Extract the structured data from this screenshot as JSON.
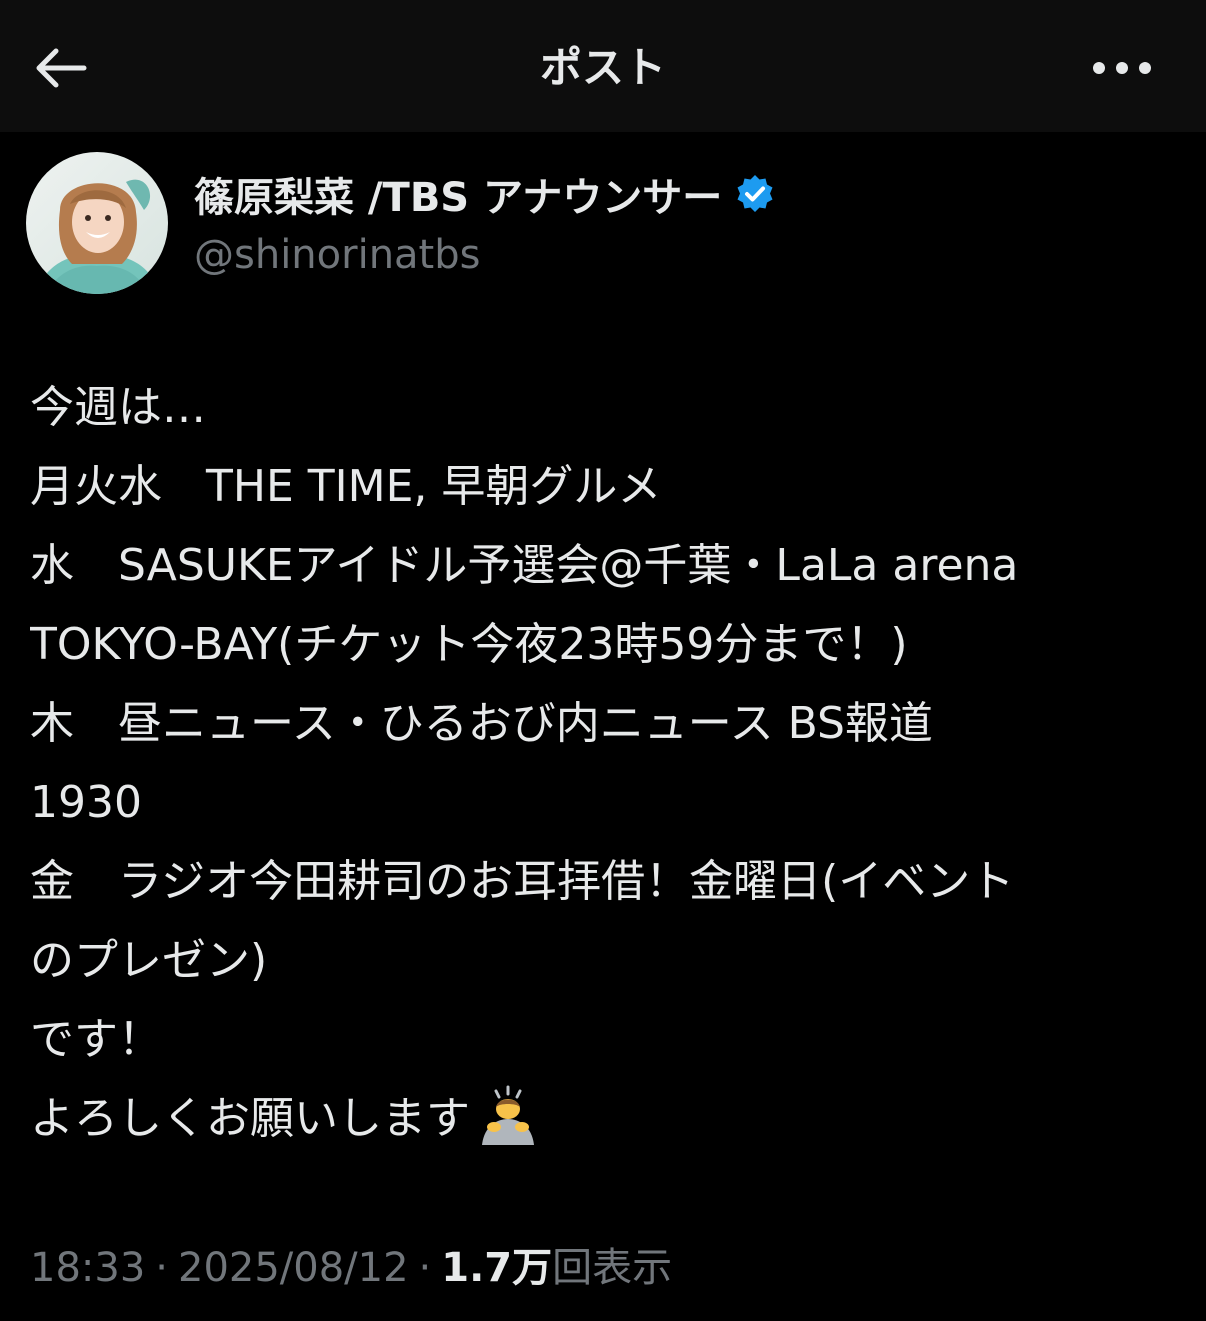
{
  "header": {
    "title": "ポスト",
    "back_icon": "arrow-left-icon",
    "more_icon": "more-horizontal-icon"
  },
  "author": {
    "display_name": "篠原梨菜 /TBS アナウンサー",
    "handle": "@shinorinatbs",
    "verified_icon": "verified-badge-icon",
    "verified_color": "#1d9bf0"
  },
  "post": {
    "lines": [
      "今週は…",
      "月火水　THE TIME, 早朝グルメ",
      "水　SASUKEアイドル予選会@千葉・LaLa arena",
      "TOKYO-BAY(チケット今夜23時59分まで！)",
      "木　昼ニュース・ひるおび内ニュース BS報道",
      "1930",
      "金　ラジオ今田耕司のお耳拝借！金曜日(イベント",
      "のプレゼン)",
      "です！",
      "よろしくお願いします"
    ],
    "emoji_icon": "person-bowing-emoji-icon"
  },
  "meta": {
    "time": "18:33",
    "separator": "·",
    "date": "2025/08/12",
    "views_count": "1.7万",
    "views_label": "回表示"
  },
  "colors": {
    "background": "#000000",
    "header_background": "#0d0d0d",
    "text_primary": "#e7e9ea",
    "text_secondary": "#71767b",
    "accent": "#1d9bf0"
  }
}
